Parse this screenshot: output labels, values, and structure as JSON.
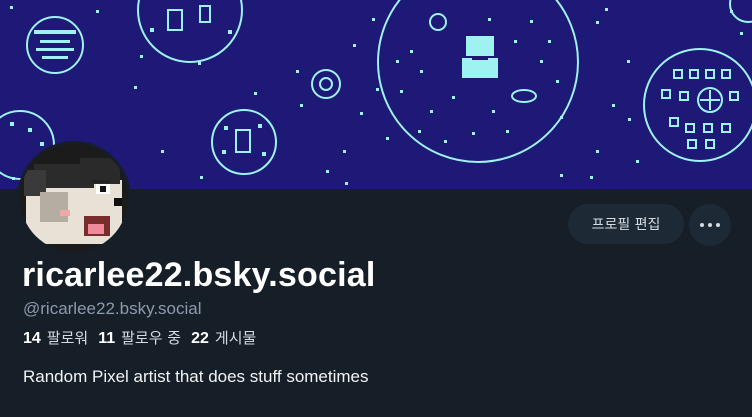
{
  "profile": {
    "display_name": "ricarlee22.bsky.social",
    "handle": "@ricarlee22.bsky.social",
    "bio": "Random Pixel artist that does stuff sometimes",
    "followers_count": "14",
    "followers_label": "팔로워",
    "following_count": "11",
    "following_label": "팔로우 중",
    "posts_count": "22",
    "posts_label": "게시물"
  },
  "actions": {
    "edit_profile_label": "프로필 편집",
    "more_icon": "ellipsis-icon"
  },
  "colors": {
    "background": "#161e27",
    "banner_background": "#1e1877",
    "banner_pixel": "#9ef2f2",
    "button_background": "#1e2936",
    "handle_text": "#8c9aab"
  }
}
